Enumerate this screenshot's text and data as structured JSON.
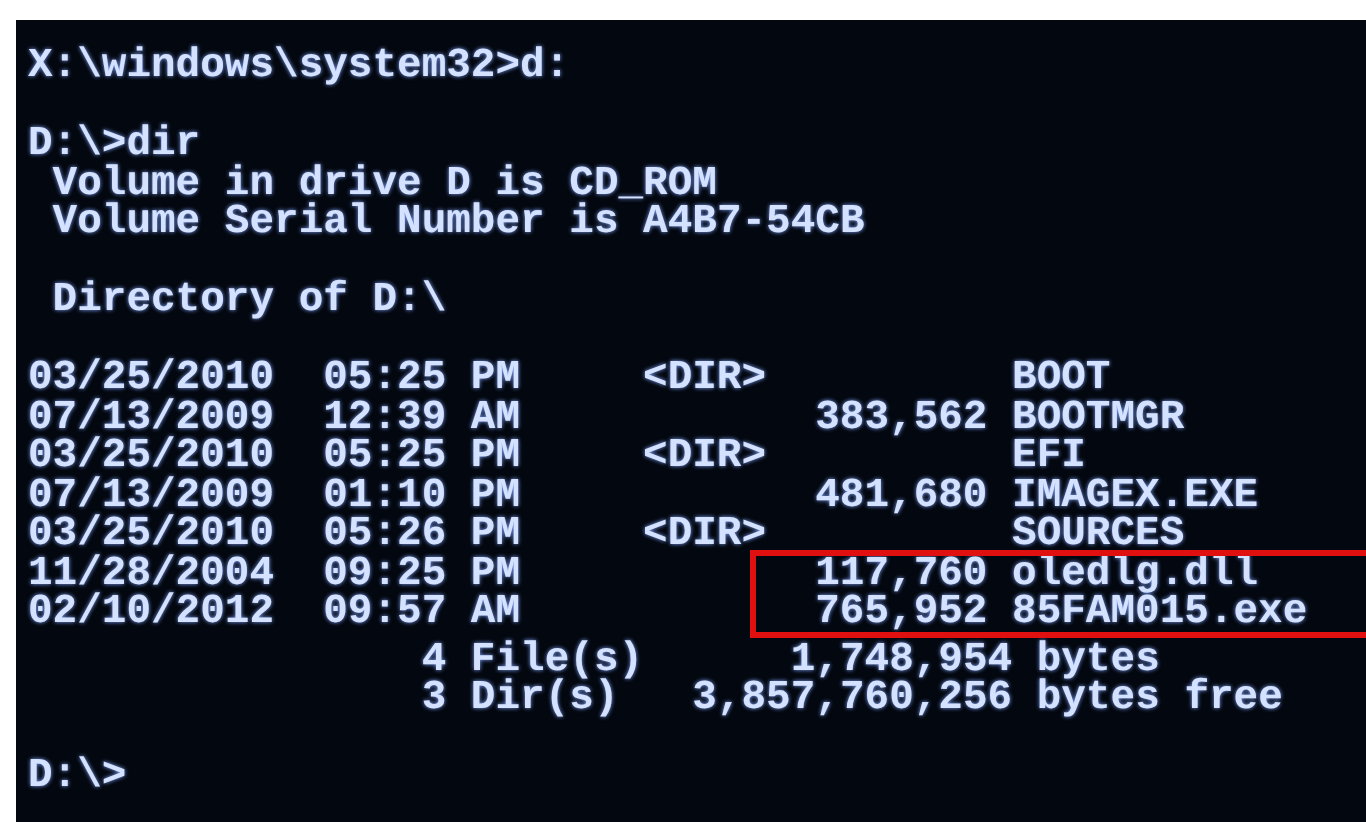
{
  "console": {
    "command_line": "X:\\windows\\system32>d:",
    "dir_command": "D:\\>dir",
    "volume_lines": [
      " Volume in drive D is CD_ROM",
      " Volume Serial Number is A4B7-54CB"
    ],
    "directory_heading": " Directory of D:\\",
    "table": {
      "rows": [
        {
          "date": "03/25/2010",
          "time": "05:25 PM",
          "type": "<DIR>",
          "name": "BOOT",
          "highlighted": false
        },
        {
          "date": "07/13/2009",
          "time": "12:39 AM",
          "size": "383,562",
          "name": "BOOTMGR",
          "highlighted": false
        },
        {
          "date": "03/25/2010",
          "time": "05:25 PM",
          "type": "<DIR>",
          "name": "EFI",
          "highlighted": false
        },
        {
          "date": "07/13/2009",
          "time": "01:10 PM",
          "size": "481,680",
          "name": "IMAGEX.EXE",
          "highlighted": false
        },
        {
          "date": "03/25/2010",
          "time": "05:26 PM",
          "type": "<DIR>",
          "name": "SOURCES",
          "highlighted": false
        },
        {
          "date": "11/28/2004",
          "time": "09:25 PM",
          "size": "117,760",
          "name": "oledlg.dll",
          "highlighted": true
        },
        {
          "date": "02/10/2012",
          "time": "09:57 AM",
          "size": "765,952",
          "name": "85FAM015.exe",
          "highlighted": true
        }
      ]
    },
    "summary_lines": [
      "                4 File(s)      1,748,954 bytes",
      "                3 Dir(s)   3,857,760,256 bytes free"
    ],
    "prompt": "D:\\>"
  }
}
